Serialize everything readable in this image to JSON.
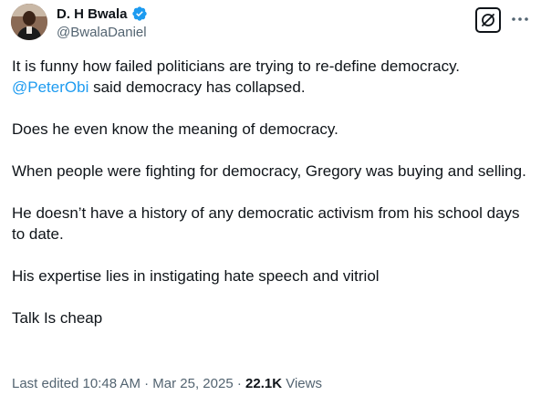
{
  "author": {
    "display_name": "D. H Bwala",
    "handle": "@BwalaDaniel",
    "verified": true,
    "verified_color": "#1d9bf0"
  },
  "icons": {
    "grok": "grok-slash-icon",
    "more": "more-dots-icon",
    "verified": "verified-badge-icon"
  },
  "tweet": {
    "line1": "It is funny how failed politicians are trying to re-define democracy.",
    "mention": "@PeterObi",
    "line1_rest": " said democracy has collapsed.",
    "para2": "Does he even know the meaning of democracy.",
    "para3": "When  people were fighting for democracy, Gregory was buying and selling.",
    "para4": "He doesn’t have a history of any democratic activism from his school days to date.",
    "para5": "His expertise lies in instigating hate speech and vitriol",
    "para6": "Talk Is cheap"
  },
  "meta": {
    "edited_label": "Last edited 10:48 AM",
    "separator": " · ",
    "date": "Mar 25, 2025",
    "views_count": "22.1K",
    "views_label": " Views"
  },
  "colors": {
    "text": "#0f1419",
    "secondary": "#536471",
    "link": "#1d9bf0"
  }
}
